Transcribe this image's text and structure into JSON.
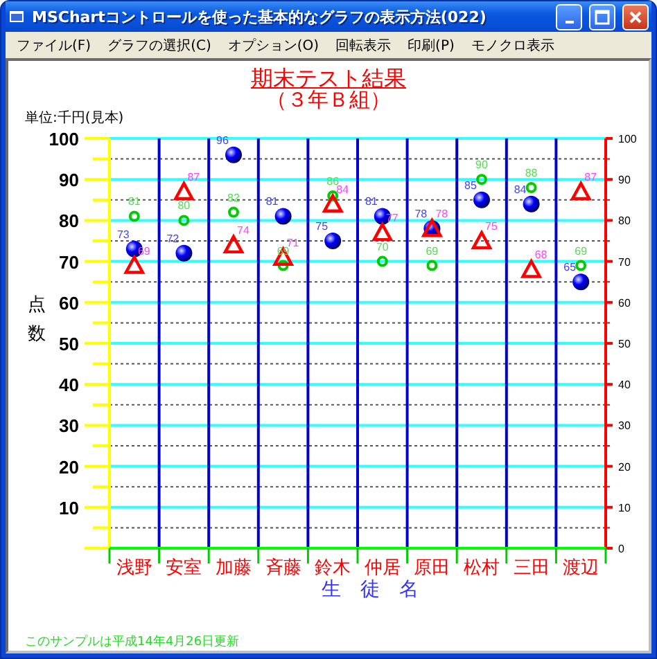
{
  "window": {
    "title": "MSChartコントロールを使った基本的なグラフの表示方法(022)"
  },
  "menu": [
    "ファイル(F)",
    "グラフの選択(C)",
    "オプション(O)",
    "回転表示",
    "印刷(P)",
    "モノクロ表示"
  ],
  "chart": {
    "left_axis_labels": [
      "100",
      "90",
      "80",
      "70",
      "60",
      "50",
      "40",
      "30",
      "20",
      "10"
    ],
    "title": "期末テスト結果",
    "subtitle": "（３年Ｂ組）",
    "unit": "単位:千円(見本)",
    "footer": "このサンプルは平成14年4月26日更新",
    "chart_data": {
      "type": "scatter",
      "ylabel": "点数",
      "xlabel": "生　徒　名",
      "categories": [
        "浅野",
        "安室",
        "加藤",
        "斉藤",
        "鈴木",
        "仲居",
        "原田",
        "松村",
        "三田",
        "渡辺"
      ],
      "ylim": [
        0,
        100
      ],
      "yticks": [
        0,
        10,
        20,
        30,
        40,
        50,
        60,
        70,
        80,
        90,
        100
      ],
      "grid": true,
      "data_labels": true,
      "series": [
        {
          "color": "#0000ff",
          "values": [
            73,
            72,
            96,
            81,
            75,
            81,
            78,
            85,
            84,
            65
          ]
        },
        {
          "color": "#00cc00",
          "values": [
            81,
            80,
            82,
            69,
            86,
            70,
            69,
            90,
            88,
            69
          ]
        },
        {
          "color": "#ff0000",
          "values": [
            69,
            87,
            74,
            71,
            84,
            77,
            78,
            75,
            68,
            87
          ]
        }
      ]
    }
  }
}
